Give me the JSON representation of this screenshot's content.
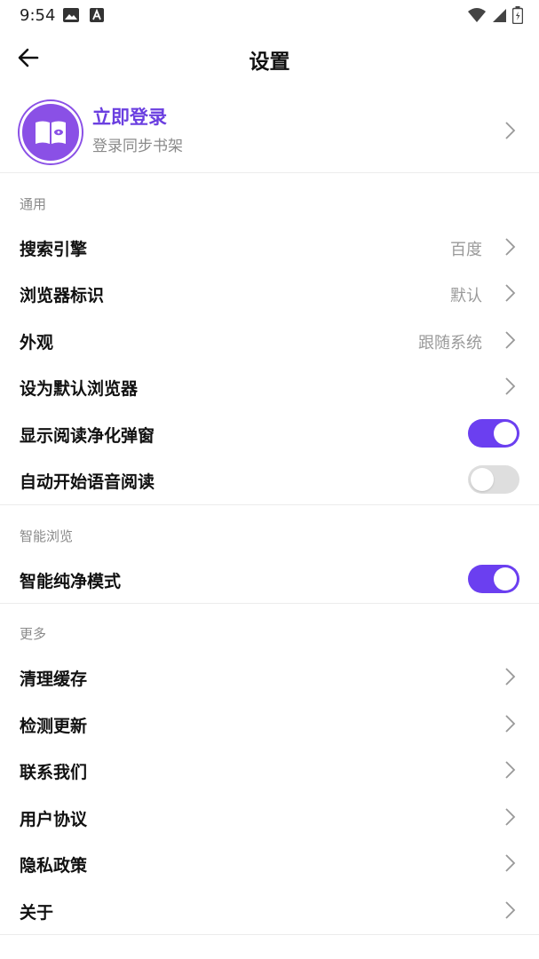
{
  "status_bar": {
    "time": "9:54",
    "icons": [
      "image-icon",
      "a-box-icon",
      "wifi-icon",
      "signal-icon",
      "battery-icon"
    ]
  },
  "app_bar": {
    "title": "设置",
    "back_icon": "arrow-left-icon"
  },
  "profile": {
    "title": "立即登录",
    "subtitle": "登录同步书架",
    "accent": "#6b3fe0",
    "avatar_color": "#8a50e6"
  },
  "sections": {
    "general": {
      "header": "通用",
      "items": [
        {
          "label": "搜索引擎",
          "value": "百度"
        },
        {
          "label": "浏览器标识",
          "value": "默认"
        },
        {
          "label": "外观",
          "value": "跟随系统"
        },
        {
          "label": "设为默认浏览器",
          "value": ""
        },
        {
          "label": "显示阅读净化弹窗",
          "toggle": true
        },
        {
          "label": "自动开始语音阅读",
          "toggle": false
        }
      ]
    },
    "smart": {
      "header": "智能浏览",
      "items": [
        {
          "label": "智能纯净模式",
          "toggle": true
        }
      ]
    },
    "more": {
      "header": "更多",
      "items": [
        {
          "label": "清理缓存"
        },
        {
          "label": "检测更新"
        },
        {
          "label": "联系我们"
        },
        {
          "label": "用户协议"
        },
        {
          "label": "隐私政策"
        },
        {
          "label": "关于"
        }
      ]
    }
  },
  "colors": {
    "toggle_on": "#6b3ff0",
    "toggle_off": "#dedede",
    "secondary_text": "#8a8a8a"
  }
}
